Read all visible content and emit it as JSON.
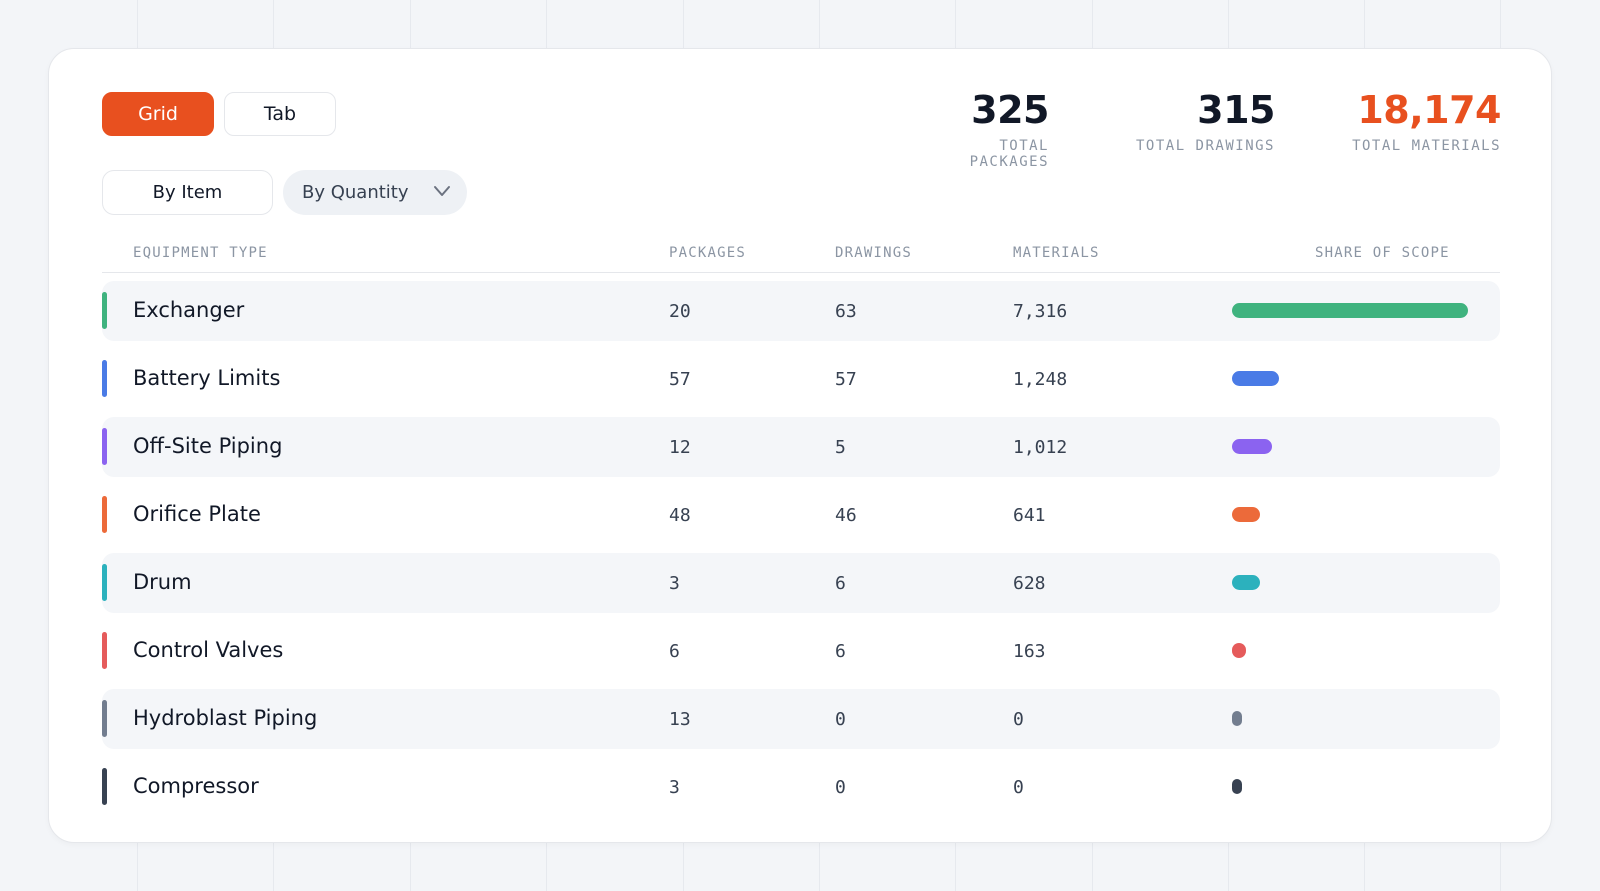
{
  "view_toggle": {
    "grid_label": "Grid",
    "tab_label": "Tab"
  },
  "filters": {
    "by_item_label": "By Item",
    "by_quantity_label": "By Quantity"
  },
  "stats": [
    {
      "value": "325",
      "label": "TOTAL PACKAGES",
      "accent": false
    },
    {
      "value": "315",
      "label": "TOTAL DRAWINGS",
      "accent": false
    },
    {
      "value": "18,174",
      "label": "TOTAL MATERIALS",
      "accent": true
    }
  ],
  "table": {
    "headers": {
      "type": "EQUIPMENT TYPE",
      "packages": "PACKAGES",
      "drawings": "DRAWINGS",
      "materials": "MATERIALS",
      "share": "SHARE OF SCOPE"
    },
    "rows": [
      {
        "name": "Exchanger",
        "packages": "20",
        "drawings": "63",
        "materials": "7,316",
        "share": 1.0,
        "color": "#3fb37f"
      },
      {
        "name": "Battery Limits",
        "packages": "57",
        "drawings": "57",
        "materials": "1,248",
        "share": 0.2,
        "color": "#4a7be6"
      },
      {
        "name": "Off-Site Piping",
        "packages": "12",
        "drawings": "5",
        "materials": "1,012",
        "share": 0.17,
        "color": "#8b63f0"
      },
      {
        "name": "Orifice Plate",
        "packages": "48",
        "drawings": "46",
        "materials": "641",
        "share": 0.12,
        "color": "#ec6a3a"
      },
      {
        "name": "Drum",
        "packages": "3",
        "drawings": "6",
        "materials": "628",
        "share": 0.12,
        "color": "#2cb1bd"
      },
      {
        "name": "Control Valves",
        "packages": "6",
        "drawings": "6",
        "materials": "163",
        "share": 0.06,
        "color": "#e55b5b"
      },
      {
        "name": "Hydroblast Piping",
        "packages": "13",
        "drawings": "0",
        "materials": "0",
        "share": 0.04,
        "color": "#727d8f"
      },
      {
        "name": "Compressor",
        "packages": "3",
        "drawings": "0",
        "materials": "0",
        "share": 0.04,
        "color": "#384252"
      }
    ]
  }
}
